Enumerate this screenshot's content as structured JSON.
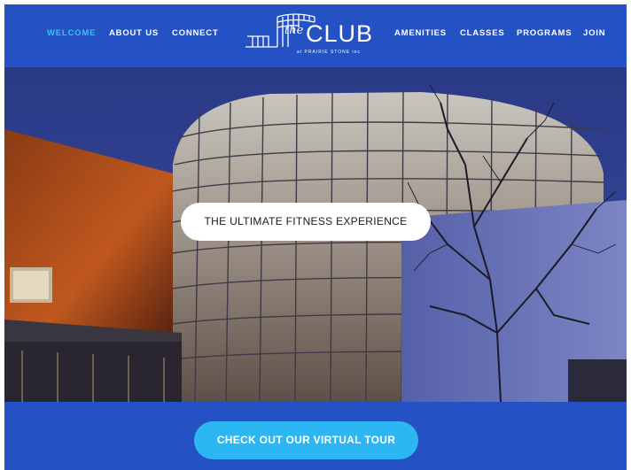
{
  "nav": {
    "left": [
      "WELCOME",
      "ABOUT US",
      "CONNECT"
    ],
    "right": [
      "AMENITIES",
      "CLASSES",
      "PROGRAMS",
      "JOIN"
    ],
    "active": "WELCOME"
  },
  "logo": {
    "the": "the",
    "club": "CLUB",
    "sub": "at PRAIRIE STONE inc"
  },
  "hero": {
    "tagline": "THE ULTIMATE FITNESS EXPERIENCE"
  },
  "cta": {
    "label": "CHECK OUT OUR VIRTUAL TOUR"
  },
  "colors": {
    "brand_blue": "#2451c4",
    "accent_cyan": "#2cb7f2",
    "active_nav": "#3fc0f5"
  }
}
